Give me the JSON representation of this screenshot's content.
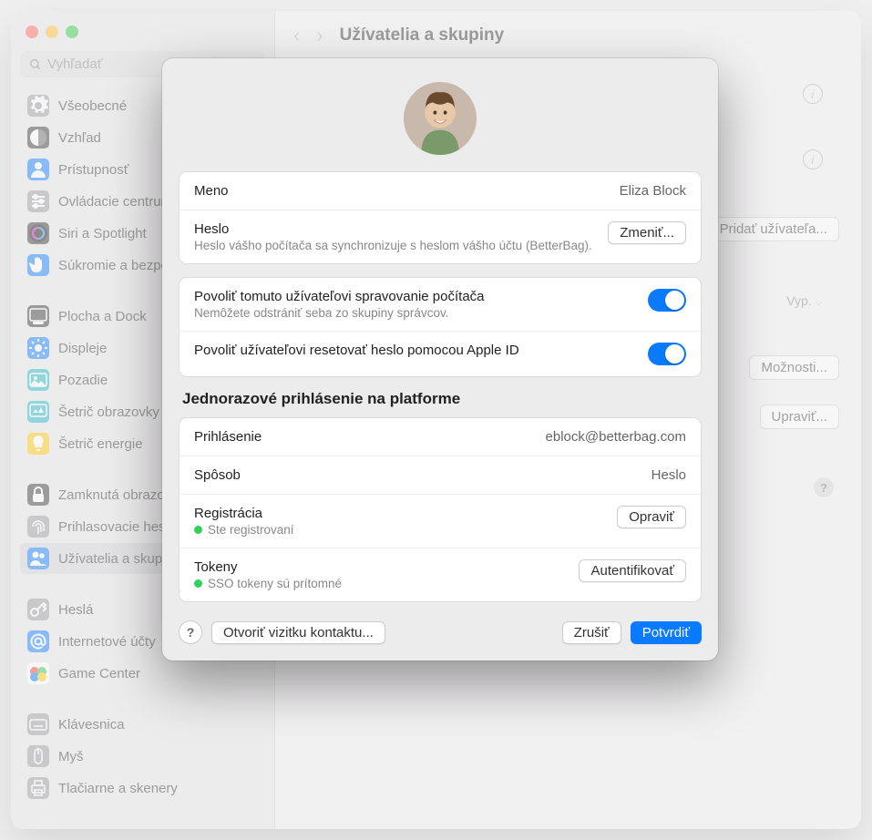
{
  "window": {
    "title": "Užívatelia a skupiny",
    "search_placeholder": "Vyhľadať"
  },
  "sidebar": {
    "items": [
      {
        "label": "Všeobecné",
        "icon": "gear",
        "color": "#9a9a9f"
      },
      {
        "label": "Vzhľad",
        "icon": "circle-halved",
        "color": "#333"
      },
      {
        "label": "Prístupnosť",
        "icon": "person",
        "color": "#0a7aff"
      },
      {
        "label": "Ovládacie centrum",
        "icon": "sliders",
        "color": "#9a9a9f"
      },
      {
        "label": "Siri a Spotlight",
        "icon": "siri",
        "color": "#333"
      },
      {
        "label": "Súkromie a bezpečnosť",
        "icon": "hand",
        "color": "#0a7aff"
      },
      {
        "label": "Plocha a Dock",
        "icon": "dock",
        "color": "#333"
      },
      {
        "label": "Displeje",
        "icon": "sun",
        "color": "#0a7aff"
      },
      {
        "label": "Pozadie",
        "icon": "photo",
        "color": "#1eb7c4"
      },
      {
        "label": "Šetrič obrazovky",
        "icon": "screensaver",
        "color": "#1eb7c4"
      },
      {
        "label": "Šetrič energie",
        "icon": "bulb",
        "color": "#ffc600"
      },
      {
        "label": "Zamknutá obrazovka",
        "icon": "lock",
        "color": "#333"
      },
      {
        "label": "Prihlasovacie heslo",
        "icon": "fingerprint",
        "color": "#9a9a9f"
      },
      {
        "label": "Užívatelia a skupiny",
        "icon": "people",
        "color": "#0a7aff",
        "selected": true
      },
      {
        "label": "Heslá",
        "icon": "key",
        "color": "#9a9a9f"
      },
      {
        "label": "Internetové účty",
        "icon": "at",
        "color": "#0a7aff"
      },
      {
        "label": "Game Center",
        "icon": "game",
        "color": "#fff"
      },
      {
        "label": "Klávesnica",
        "icon": "keyboard",
        "color": "#9a9a9f"
      },
      {
        "label": "Myš",
        "icon": "mouse",
        "color": "#9a9a9f"
      },
      {
        "label": "Tlačiarne a skenery",
        "icon": "printer",
        "color": "#9a9a9f"
      }
    ]
  },
  "background": {
    "add_user_btn": "Pridať užívateľa...",
    "off_label": "Vyp.",
    "options_btn": "Možnosti...",
    "edit_btn": "Upraviť..."
  },
  "modal": {
    "name_label": "Meno",
    "name_value": "Eliza Block",
    "password_label": "Heslo",
    "password_sub": "Heslo vášho počítača sa synchronizuje s heslom vášho účtu (BetterBag).",
    "change_btn": "Zmeniť...",
    "allow_admin_label": "Povoliť tomuto užívateľovi spravovanie počítača",
    "allow_admin_sub": "Nemôžete odstrániť seba zo skupiny správcov.",
    "allow_reset_label": "Povoliť užívateľovi resetovať heslo pomocou Apple ID",
    "sso_header": "Jednorazové prihlásenie na platforme",
    "login_label": "Prihlásenie",
    "login_value": "eblock@betterbag.com",
    "method_label": "Spôsob",
    "method_value": "Heslo",
    "registration_label": "Registrácia",
    "registration_status": "Ste registrovaní",
    "repair_btn": "Opraviť",
    "tokens_label": "Tokeny",
    "tokens_status": "SSO tokeny sú prítomné",
    "auth_btn": "Autentifikovať",
    "open_card_btn": "Otvoriť vizitku kontaktu...",
    "cancel_btn": "Zrušiť",
    "confirm_btn": "Potvrdiť"
  }
}
